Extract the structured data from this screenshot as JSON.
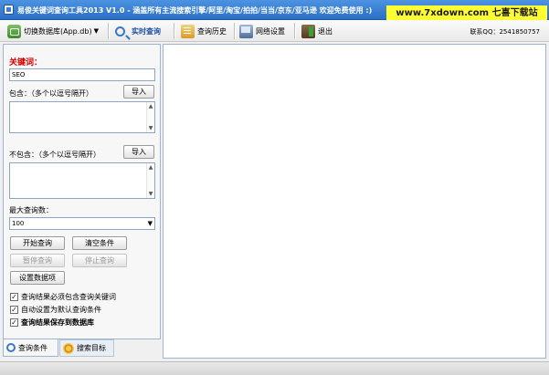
{
  "window": {
    "title": "易俊关键词查询工具2013 V1.0 - 涵盖所有主流搜索引擎/阿里/淘宝/拍拍/当当/京东/亚马逊 欢迎免费使用 :)",
    "watermark": "www.7xdown.com 七喜下载站"
  },
  "toolbar": {
    "switch_db": "切换数据库(App.db)",
    "realtime_query": "实时查询",
    "query_history": "查询历史",
    "network_settings": "网络设置",
    "exit": "退出",
    "contact": "联系QQ：2541850757"
  },
  "form": {
    "keyword_label": "关键词：",
    "keyword_value": "SEO",
    "include_label": "包含：（多个以逗号隔开）",
    "include_import": "导入",
    "exclude_label": "不包含：（多个以逗号隔开）",
    "exclude_import": "导入",
    "max_label": "最大查询数：",
    "max_value": "100"
  },
  "actions": {
    "start": "开始查询",
    "clear": "清空条件",
    "pause": "暂停查询",
    "stop": "停止查询",
    "data_settings": "设置数据项"
  },
  "options": {
    "must_contain": "查询结果必须包含查询关键词",
    "auto_default": "自动设置为默认查询条件",
    "save_db": "查询结果保存到数据库"
  },
  "tabs": {
    "conditions": "查询条件",
    "targets": "搜索目标"
  }
}
